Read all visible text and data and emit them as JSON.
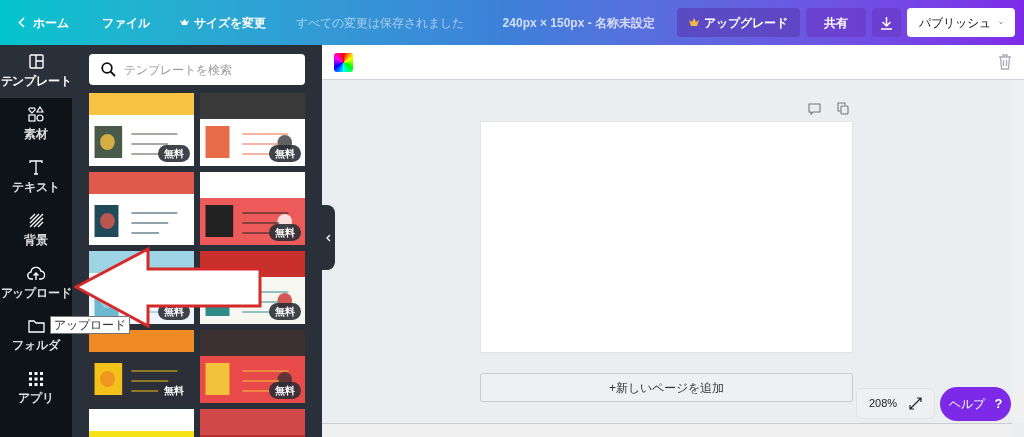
{
  "top_bar": {
    "home": "ホーム",
    "file": "ファイル",
    "resize": "サイズを変更",
    "save_status": "すべての変更は保存されました",
    "doc_info": "240px × 150px - 名称未設定",
    "upgrade": "アップグレード",
    "share": "共有",
    "publish": "パブリッシュ"
  },
  "sidebar": {
    "items": [
      {
        "label": "テンプレート",
        "kind": "template",
        "selected": true
      },
      {
        "label": "素材",
        "kind": "elements",
        "selected": false
      },
      {
        "label": "テキスト",
        "kind": "text",
        "selected": false
      },
      {
        "label": "背景",
        "kind": "background",
        "selected": false
      },
      {
        "label": "アップロード",
        "kind": "upload",
        "selected": false
      },
      {
        "label": "フォルダ",
        "kind": "folder",
        "selected": false
      },
      {
        "label": "アプリ",
        "kind": "apps",
        "selected": false
      }
    ]
  },
  "tooltip": "アップロード",
  "search": {
    "placeholder": "テンプレートを検索"
  },
  "templates": [
    {
      "kind": "picture",
      "badge": "無料"
    },
    {
      "kind": "picture",
      "badge": "無料"
    },
    {
      "kind": "picture"
    },
    {
      "kind": "picture",
      "badge": "無料"
    },
    {
      "kind": "picture",
      "badge": "無料"
    },
    {
      "kind": "picture",
      "badge": "無料"
    },
    {
      "kind": "picture",
      "badge": "無料"
    },
    {
      "kind": "picture",
      "badge": "無料"
    },
    {
      "kind": "picture"
    },
    {
      "kind": "picture"
    }
  ],
  "canvas": {
    "add_page": "+新しいページを追加",
    "zoom": "208%",
    "help": "ヘルプ",
    "help_mark": "?"
  }
}
